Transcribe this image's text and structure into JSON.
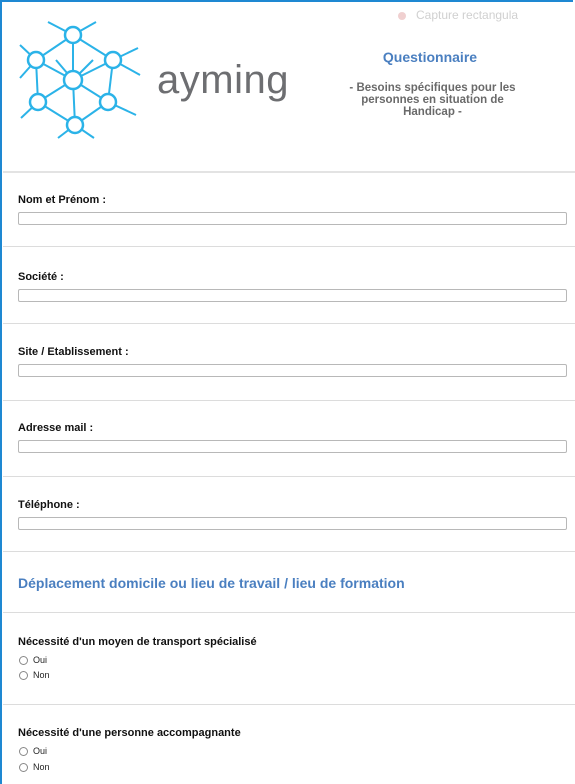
{
  "overlay": {
    "capture_label": "Capture rectangula"
  },
  "header": {
    "brand": "ayming",
    "title": "Questionnaire",
    "subtitle_lines": [
      "- Besoins spécifiques pour les",
      "personnes en situation de",
      "Handicap -"
    ]
  },
  "fields": {
    "nom": {
      "label": "Nom et Prénom :",
      "value": ""
    },
    "societe": {
      "label": "Société :",
      "value": ""
    },
    "site": {
      "label": "Site / Etablissement :",
      "value": ""
    },
    "mail": {
      "label": "Adresse mail :",
      "value": ""
    },
    "telephone": {
      "label": "Téléphone :",
      "value": ""
    }
  },
  "section": {
    "title": "Déplacement domicile ou lieu de travail / lieu de formation"
  },
  "questions": {
    "transport": {
      "label": "Nécessité d'un moyen de transport spécialisé",
      "options": [
        "Oui",
        "Non"
      ]
    },
    "accompagnant": {
      "label": "Nécessité d'une personne accompagnante",
      "options": [
        "Oui",
        "Non"
      ]
    }
  },
  "colors": {
    "accent": "#4a7fc0",
    "logo": "#2bb3e8",
    "frame": "#1e88d2"
  }
}
